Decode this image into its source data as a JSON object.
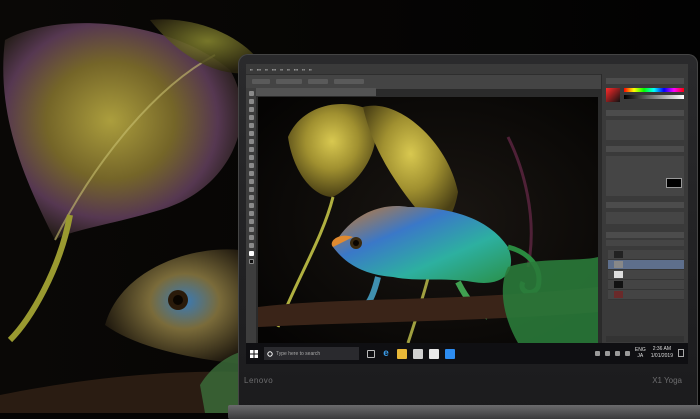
{
  "device": {
    "brand": "Lenovo",
    "model": "X1 Yoga"
  },
  "taskbar": {
    "search_placeholder": "Type here to search",
    "language_top": "ENG",
    "language_bottom": "JA",
    "time": "2:36 AM",
    "date": "1/01/2019",
    "icons": [
      "windows-start-icon",
      "cortana-icon",
      "task-view-icon",
      "edge-icon",
      "file-explorer-icon",
      "store-icon",
      "mail-icon",
      "photoshop-icon"
    ]
  },
  "colors": {
    "accent": "#2d8cf0",
    "taskbar": "#0f0f12",
    "ps_panel": "#3a3a3a"
  }
}
